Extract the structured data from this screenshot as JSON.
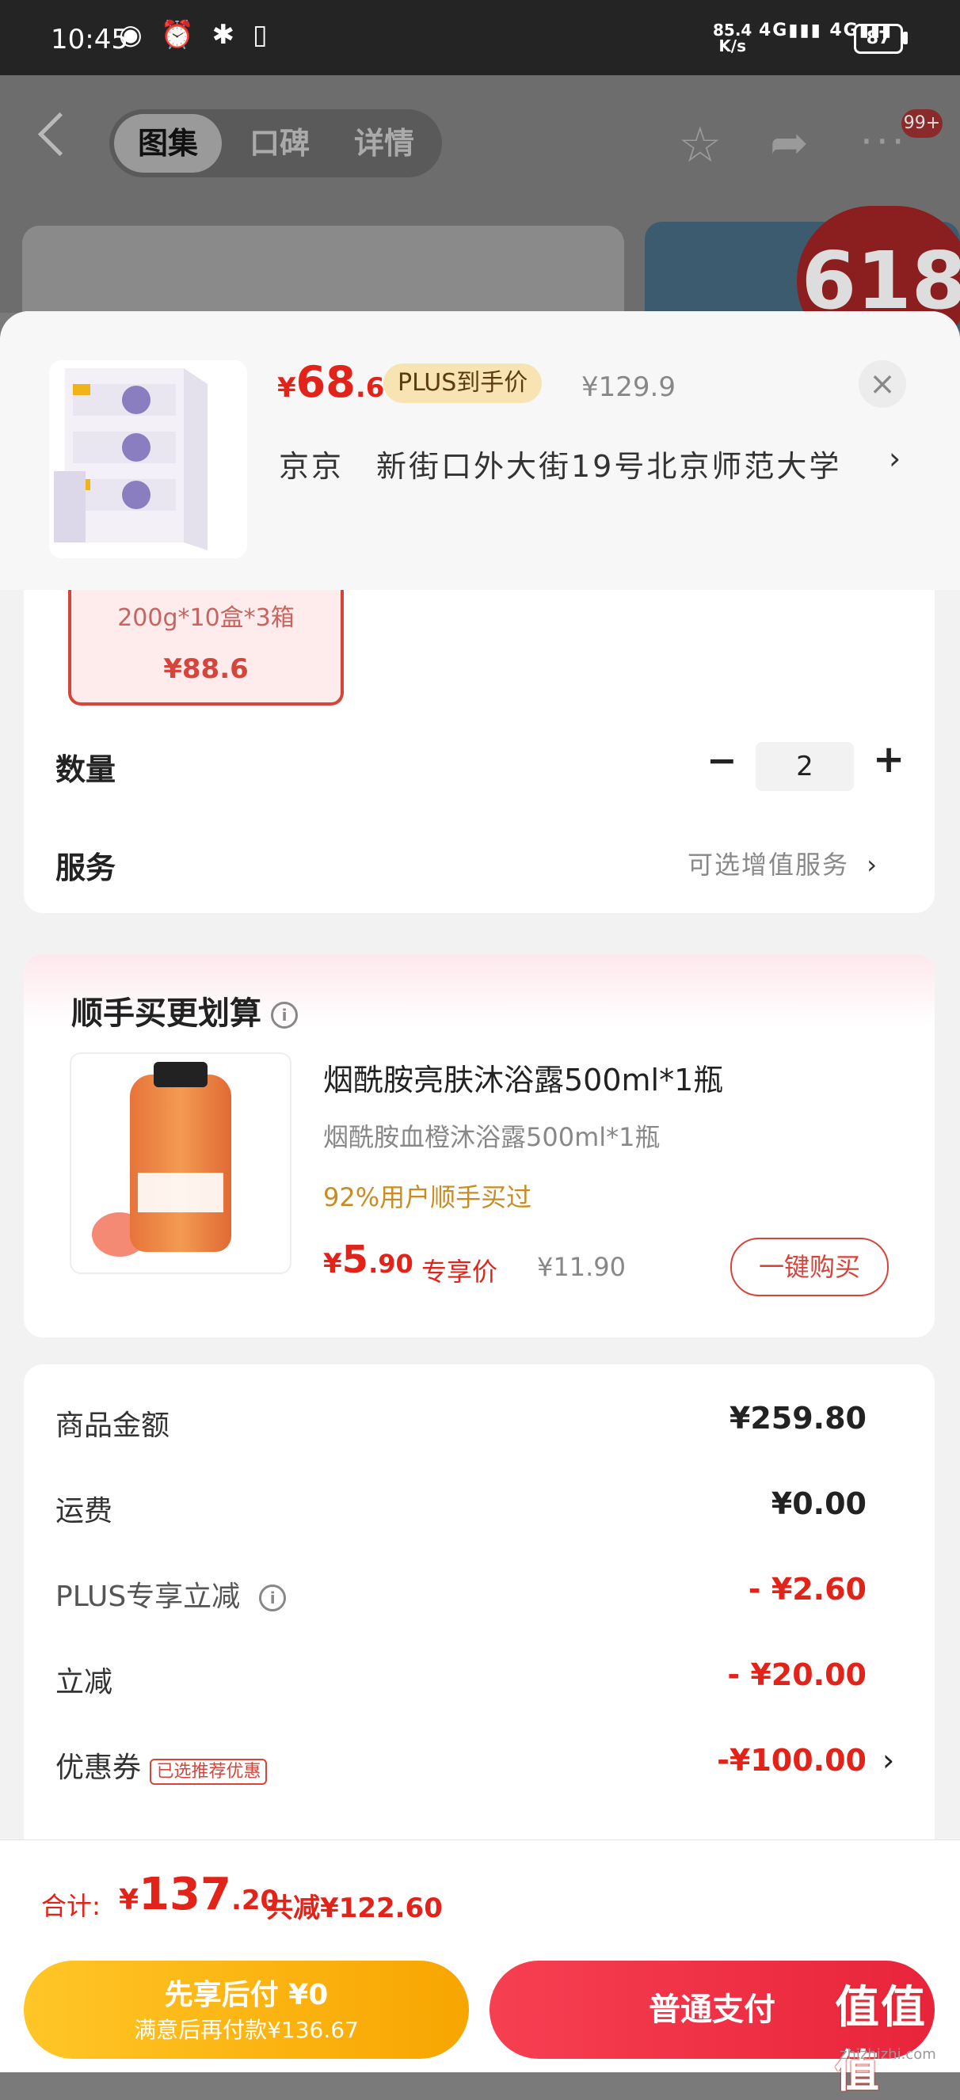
{
  "status_bar": {
    "time": "10:45",
    "speed_value": "85.4",
    "speed_unit": "K/s",
    "signal1": "4G",
    "signal2": "4G",
    "battery": "87"
  },
  "nav": {
    "tabs": [
      "图集",
      "口碑",
      "详情"
    ],
    "active_tab": 0,
    "message_badge": "99+"
  },
  "gallery": {
    "badge": "618"
  },
  "sheet": {
    "price": {
      "yen": "¥",
      "int": "68",
      "dec": ".6"
    },
    "plus_tag": "PLUS到手价",
    "original_price": "¥129.9",
    "close": "×",
    "address": "京京　新街口外大街19号北京师范大学",
    "address_chevron": "›",
    "sku": {
      "label": "200g*10盒*3箱",
      "price": "¥88.6"
    },
    "quantity": {
      "label": "数量",
      "minus": "−",
      "value": "2",
      "plus": "+"
    },
    "service": {
      "label": "服务",
      "value": "可选增值服务",
      "chevron": "›"
    }
  },
  "addon": {
    "title": "顺手买更划算",
    "info": "i",
    "name": "烟酰胺亮肤沐浴露500ml*1瓶",
    "subtitle": "烟酰胺血橙沐浴露500ml*1瓶",
    "rate": "92%用户顺手买过",
    "price_yen": "¥",
    "price_int": "5",
    "price_dec": ".90",
    "exclusive": "专享价",
    "orig_price": "¥11.90",
    "buy": "一键购买"
  },
  "summary": {
    "rows": [
      {
        "label": "商品金额",
        "value": "¥259.80"
      },
      {
        "label": "运费",
        "value": "¥0.00"
      },
      {
        "label": "PLUS专享立减",
        "value": "- ¥2.60"
      },
      {
        "label": "立减",
        "value": "- ¥20.00"
      },
      {
        "label": "优惠券",
        "value": "-¥100.00"
      }
    ],
    "coupon_tag": "已选推荐优惠",
    "coupon_chevron": "›"
  },
  "bottom": {
    "total_label": "合计:",
    "total_yen": "¥",
    "total_int": "137",
    "total_dec": ".20",
    "total_save": "共减¥122.60",
    "later_title": "先享后付 ¥0",
    "later_sub": "满意后再付款¥136.67",
    "pay": "普通支付"
  },
  "watermark": {
    "logo": "值值值",
    "site": "zhizhizhi.com"
  }
}
